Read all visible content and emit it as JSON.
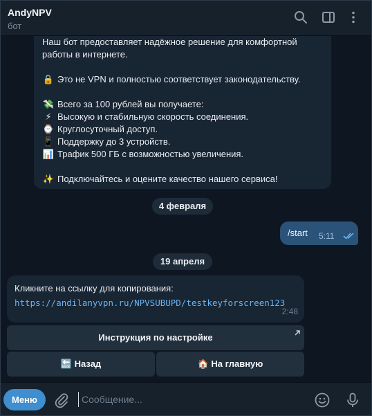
{
  "header": {
    "title": "AndyNPV",
    "subtitle": "бот",
    "icons": [
      "search-icon",
      "sidebar-toggle-icon",
      "more-vertical-icon"
    ]
  },
  "messages": {
    "intro": {
      "lines": [
        "Наш бот предоставляет надёжное решение для комфортной",
        "работы в интернете.",
        "",
        "Это не VPN и полностью соответствует законодательству.",
        "",
        "Всего за 100 рублей вы получаете:",
        "Высокую  и стабильную скорость соединения.",
        "Круглосуточный доступ.",
        "Поддержку до 3 устройств.",
        "Трафик 500 ГБ с возможностью увеличения.",
        "",
        "Подключайтесь и оцените качество нашего сервиса!"
      ],
      "emojis": {
        "lock": "🔒",
        "money": "💸",
        "bolt": "⚡",
        "clock": "⌚",
        "phone": "📱",
        "chart": "📊",
        "sparkles": "✨"
      }
    },
    "date1": "4 февраля",
    "outgoing": {
      "text": "/start",
      "time": "5:11"
    },
    "date2": "19 апреля",
    "link_message": {
      "label": "Кликните на ссылку для копирования:",
      "link": "https://andilanyvpn.ru/NPVSUBUPD/testkeyforscreen123",
      "time": "2:48"
    }
  },
  "keyboard": {
    "instruction": "Инструкция по настройке",
    "back": "Назад",
    "back_emoji": "🔙",
    "home": "На главную",
    "home_emoji": "🏠"
  },
  "composer": {
    "menu_label": "Меню",
    "placeholder": "Сообщение..."
  },
  "colors": {
    "background": "#0e1621",
    "panel": "#17212b",
    "bubble_in": "#182533",
    "bubble_out": "#2b5278",
    "link": "#6ab3f3",
    "accent": "#3e8ed0"
  }
}
